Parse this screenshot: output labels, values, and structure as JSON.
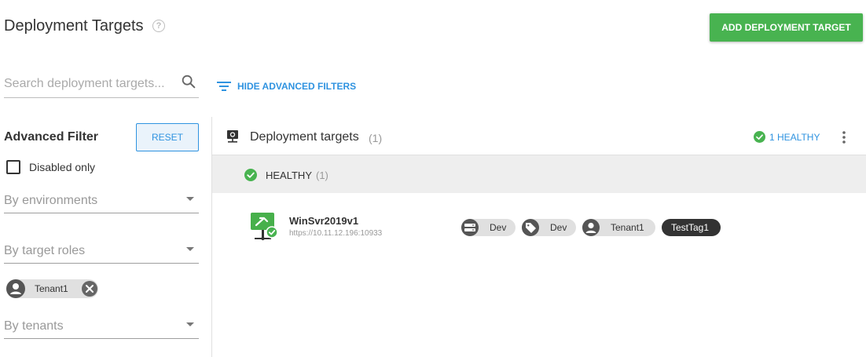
{
  "header": {
    "title": "Deployment Targets",
    "add_button": "ADD DEPLOYMENT TARGET"
  },
  "search": {
    "placeholder": "Search deployment targets...",
    "value": ""
  },
  "advanced_toggle": "HIDE ADVANCED FILTERS",
  "filters": {
    "title": "Advanced Filter",
    "reset": "RESET",
    "disabled_only": "Disabled only",
    "environments": "By environments",
    "target_roles": "By target roles",
    "selected_tenant": "Tenant1",
    "tenants": "By tenants"
  },
  "card": {
    "title": "Deployment targets",
    "count": "(1)",
    "health_summary": "1 HEALTHY"
  },
  "group": {
    "title": "HEALTHY",
    "count": "(1)"
  },
  "target": {
    "name": "WinSvr2019v1",
    "uri": "https://10.11.12.196:10933",
    "chips": [
      {
        "icon": "server-icon",
        "label": "Dev"
      },
      {
        "icon": "tag-icon",
        "label": "Dev"
      },
      {
        "icon": "user-icon",
        "label": "Tenant1"
      }
    ],
    "tag": "TestTag1"
  },
  "colors": {
    "primary": "#2f93e0",
    "success": "#48b350",
    "chip": "#e0e0e0"
  }
}
